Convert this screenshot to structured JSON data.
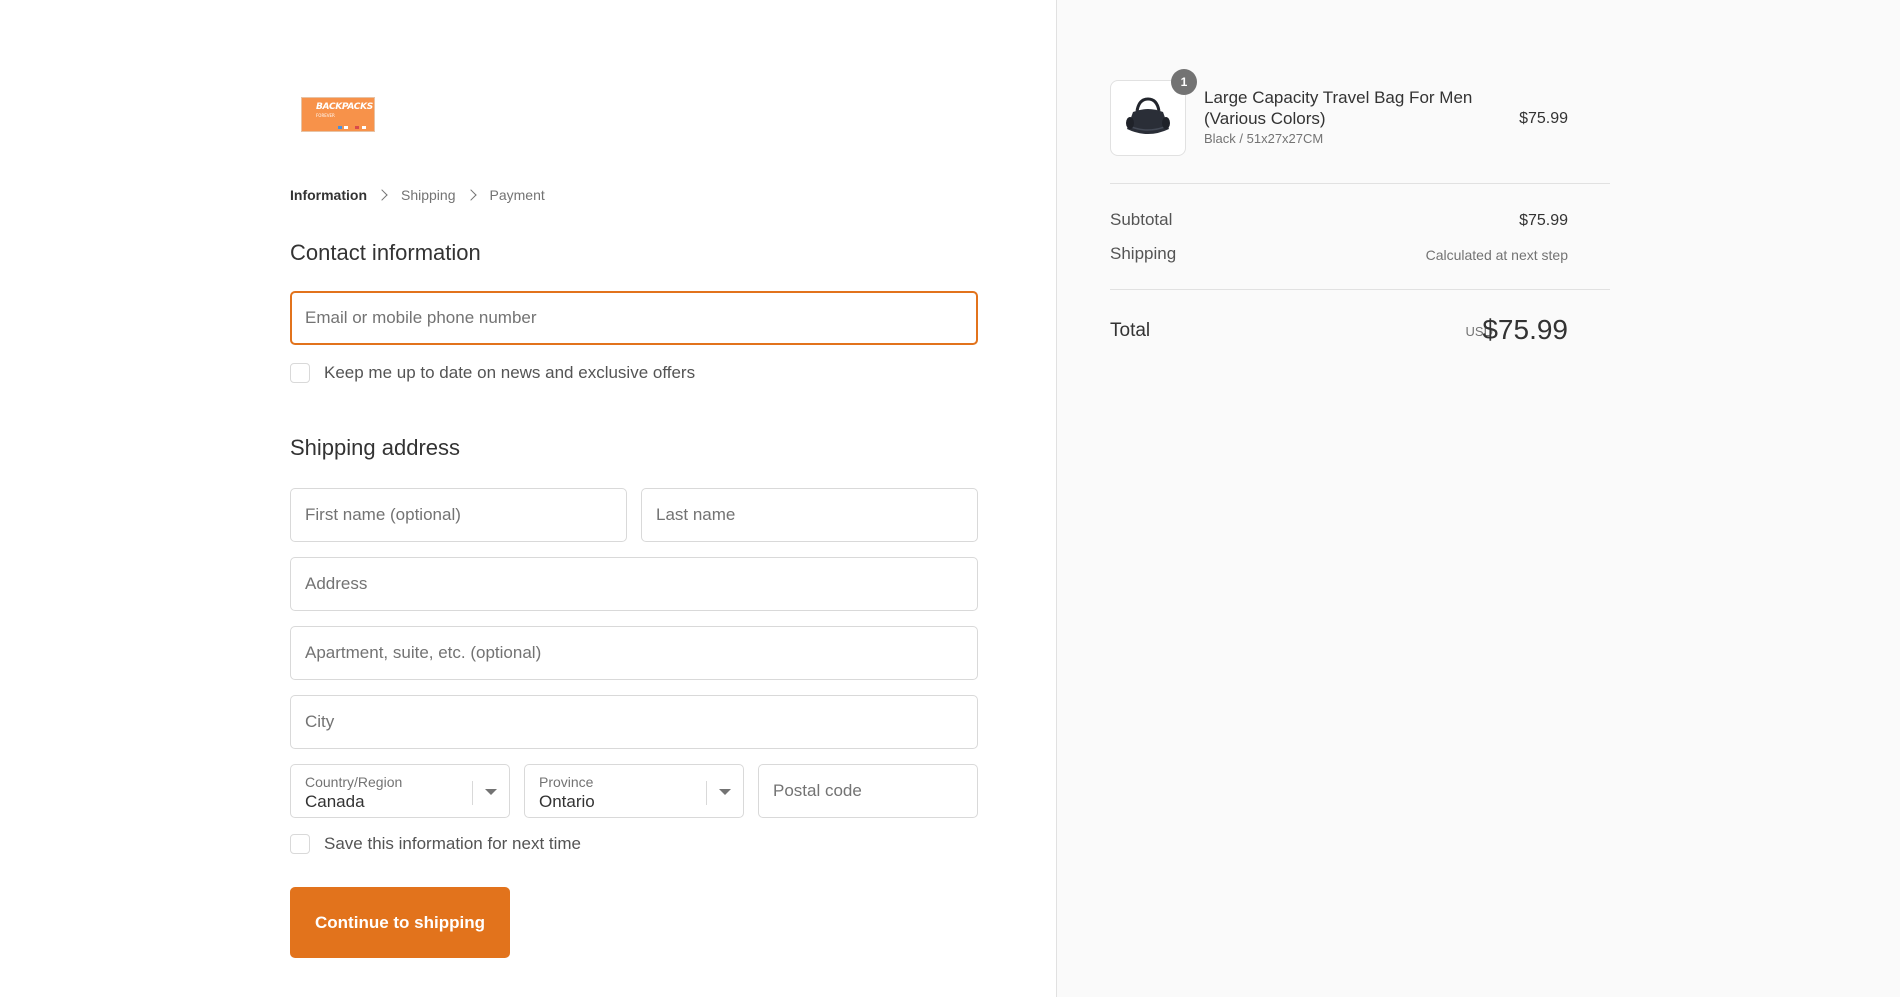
{
  "store": {
    "logo_text": "BACKPACKS",
    "logo_subtext": "FOREVER"
  },
  "breadcrumb": {
    "items": [
      "Information",
      "Shipping",
      "Payment"
    ],
    "active_index": 0
  },
  "contact": {
    "title": "Contact information",
    "email_placeholder": "Email or mobile phone number",
    "email_value": "",
    "newsletter_label": "Keep me up to date on news and exclusive offers",
    "newsletter_checked": false
  },
  "shipping_address": {
    "title": "Shipping address",
    "first_name_placeholder": "First name (optional)",
    "last_name_placeholder": "Last name",
    "address_placeholder": "Address",
    "apartment_placeholder": "Apartment, suite, etc. (optional)",
    "city_placeholder": "City",
    "country_label": "Country/Region",
    "country_value": "Canada",
    "province_label": "Province",
    "province_value": "Ontario",
    "postal_placeholder": "Postal code",
    "save_info_label": "Save this information for next time",
    "save_info_checked": false
  },
  "actions": {
    "continue_label": "Continue to shipping"
  },
  "order_summary": {
    "product": {
      "quantity": "1",
      "name": "Large Capacity Travel Bag For Men (Various Colors)",
      "variant": "Black / 51x27x27CM",
      "price": "$75.99",
      "image_icon": "duffel-bag-icon"
    },
    "subtotal_label": "Subtotal",
    "subtotal_value": "$75.99",
    "shipping_label": "Shipping",
    "shipping_value": "Calculated at next step",
    "total_label": "Total",
    "currency": "USD",
    "total_value": "$75.99"
  },
  "colors": {
    "accent": "#e2731c",
    "sidebar_bg": "#fafafa"
  }
}
